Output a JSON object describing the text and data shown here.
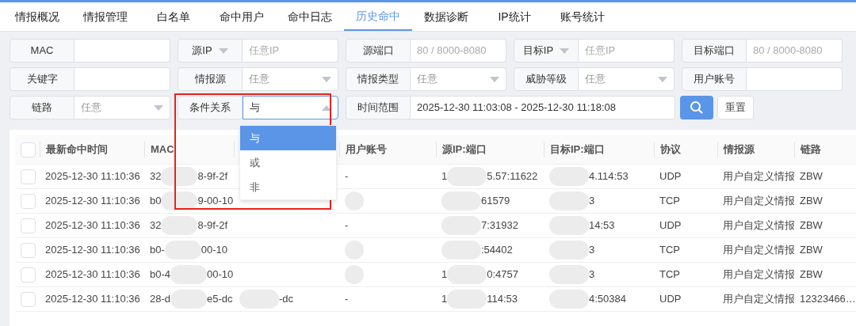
{
  "tabs": [
    {
      "label": "情报概况",
      "selected": false
    },
    {
      "label": "情报管理",
      "selected": false
    },
    {
      "label": "白名单",
      "selected": false
    },
    {
      "label": "命中用户",
      "selected": false
    },
    {
      "label": "命中日志",
      "selected": false
    },
    {
      "label": "历史命中",
      "selected": true
    },
    {
      "label": "数据诊断",
      "selected": false
    },
    {
      "label": "IP统计",
      "selected": false
    },
    {
      "label": "账号统计",
      "selected": false
    }
  ],
  "filters": [
    [
      {
        "kind": "input",
        "label": "MAC"
      },
      {
        "kind": "ip",
        "label": "源IP",
        "placeholder": "任意IP"
      },
      {
        "kind": "input",
        "label": "源端口",
        "placeholder": "80 / 8000-8080"
      },
      {
        "kind": "ip",
        "label": "目标IP",
        "placeholder": "任意IP"
      },
      {
        "kind": "input",
        "label": "目标端口",
        "placeholder": "80 / 8000-8080"
      }
    ],
    [
      {
        "kind": "input",
        "label": "关键字"
      },
      {
        "kind": "select",
        "label": "情报源",
        "placeholder": "任意",
        "open": false
      },
      {
        "kind": "select",
        "label": "情报类型",
        "placeholder": "任意",
        "open": false
      },
      {
        "kind": "select",
        "label": "威胁等级",
        "placeholder": "任意",
        "open": false
      },
      {
        "kind": "input",
        "label": "用户账号"
      }
    ],
    [
      {
        "kind": "select",
        "label": "链路",
        "placeholder": "任意",
        "open": false
      },
      {
        "kind": "select",
        "label": "条件关系",
        "value": "与",
        "open": true,
        "options": [
          {
            "label": "与",
            "selected": true
          },
          {
            "label": "或",
            "selected": false
          },
          {
            "label": "非",
            "selected": false
          }
        ]
      },
      {
        "kind": "range",
        "label": "时间范围",
        "value": "2025-12-30 11:03:08 - 2025-12-30 11:18:08"
      }
    ]
  ],
  "reset_button": "重置",
  "table": {
    "all_checked": false,
    "columns": [
      "最新命中时间",
      "MAC",
      null,
      "用户账号",
      "源IP:端口",
      "目标IP:端口",
      "协议",
      "情报源",
      "链路"
    ],
    "rows": [
      {
        "checked": false,
        "cells": [
          {
            "kind": "text",
            "text": "2025-12-30 11:10:36"
          },
          {
            "kind": "split",
            "head": "32",
            "tail": "8-9f-2f"
          },
          {
            "kind": "empty"
          },
          {
            "kind": "text",
            "text": "-"
          },
          {
            "kind": "split",
            "head": "1",
            "tail": "5.57:11622"
          },
          {
            "kind": "split",
            "tail": "4.114:53"
          },
          {
            "kind": "text",
            "text": "UDP"
          },
          {
            "kind": "text",
            "text": "用户自定义情报"
          },
          {
            "kind": "text",
            "text": "ZBW"
          }
        ]
      },
      {
        "checked": false,
        "cells": [
          {
            "kind": "text",
            "text": "2025-12-30 11:10:36"
          },
          {
            "kind": "split",
            "head": "b0",
            "tail": "9-00-10"
          },
          {
            "kind": "empty"
          },
          {
            "kind": "split"
          },
          {
            "kind": "split",
            "tail": "61579"
          },
          {
            "kind": "split",
            "tail": "3"
          },
          {
            "kind": "text",
            "text": "TCP"
          },
          {
            "kind": "text",
            "text": "用户自定义情报"
          },
          {
            "kind": "text",
            "text": "ZBW"
          }
        ]
      },
      {
        "checked": false,
        "cells": [
          {
            "kind": "text",
            "text": "2025-12-30 11:10:36"
          },
          {
            "kind": "split",
            "head": "32",
            "tail": "8-9f-2f"
          },
          {
            "kind": "empty"
          },
          {
            "kind": "text",
            "text": "-"
          },
          {
            "kind": "split",
            "tail": "7:31932"
          },
          {
            "kind": "split",
            "tail": "14:53"
          },
          {
            "kind": "text",
            "text": "UDP"
          },
          {
            "kind": "text",
            "text": "用户自定义情报"
          },
          {
            "kind": "text",
            "text": "ZBW"
          }
        ]
      },
      {
        "checked": false,
        "cells": [
          {
            "kind": "text",
            "text": "2025-12-30 11:10:36"
          },
          {
            "kind": "split",
            "head": "b0-",
            "tail": "00-10"
          },
          {
            "kind": "empty"
          },
          {
            "kind": "split"
          },
          {
            "kind": "split",
            "tail": ":54402"
          },
          {
            "kind": "split",
            "tail": "3"
          },
          {
            "kind": "text",
            "text": "TCP"
          },
          {
            "kind": "text",
            "text": "用户自定义情报"
          },
          {
            "kind": "text",
            "text": "ZBW"
          }
        ]
      },
      {
        "checked": false,
        "cells": [
          {
            "kind": "text",
            "text": "2025-12-30 11:10:36"
          },
          {
            "kind": "split",
            "head": "b0-4",
            "tail": "00-10"
          },
          {
            "kind": "empty"
          },
          {
            "kind": "split"
          },
          {
            "kind": "split",
            "head": "1",
            "tail": "0:4757"
          },
          {
            "kind": "split",
            "tail": "3"
          },
          {
            "kind": "text",
            "text": "TCP"
          },
          {
            "kind": "text",
            "text": "用户自定义情报"
          },
          {
            "kind": "text",
            "text": "ZBW"
          }
        ]
      },
      {
        "checked": false,
        "cells": [
          {
            "kind": "text",
            "text": "2025-12-30 11:10:36"
          },
          {
            "kind": "split",
            "head": "28-d",
            "tail": "e5-dc"
          },
          {
            "kind": "split",
            "tail": "-dc"
          },
          {
            "kind": "text",
            "text": "-"
          },
          {
            "kind": "split",
            "head": "1",
            "tail": "114:53"
          },
          {
            "kind": "split",
            "tail": "4:50384"
          },
          {
            "kind": "text",
            "text": "UDP"
          },
          {
            "kind": "text",
            "text": "用户自定义情报"
          },
          {
            "kind": "text",
            "text": "12323466…"
          }
        ]
      }
    ]
  }
}
